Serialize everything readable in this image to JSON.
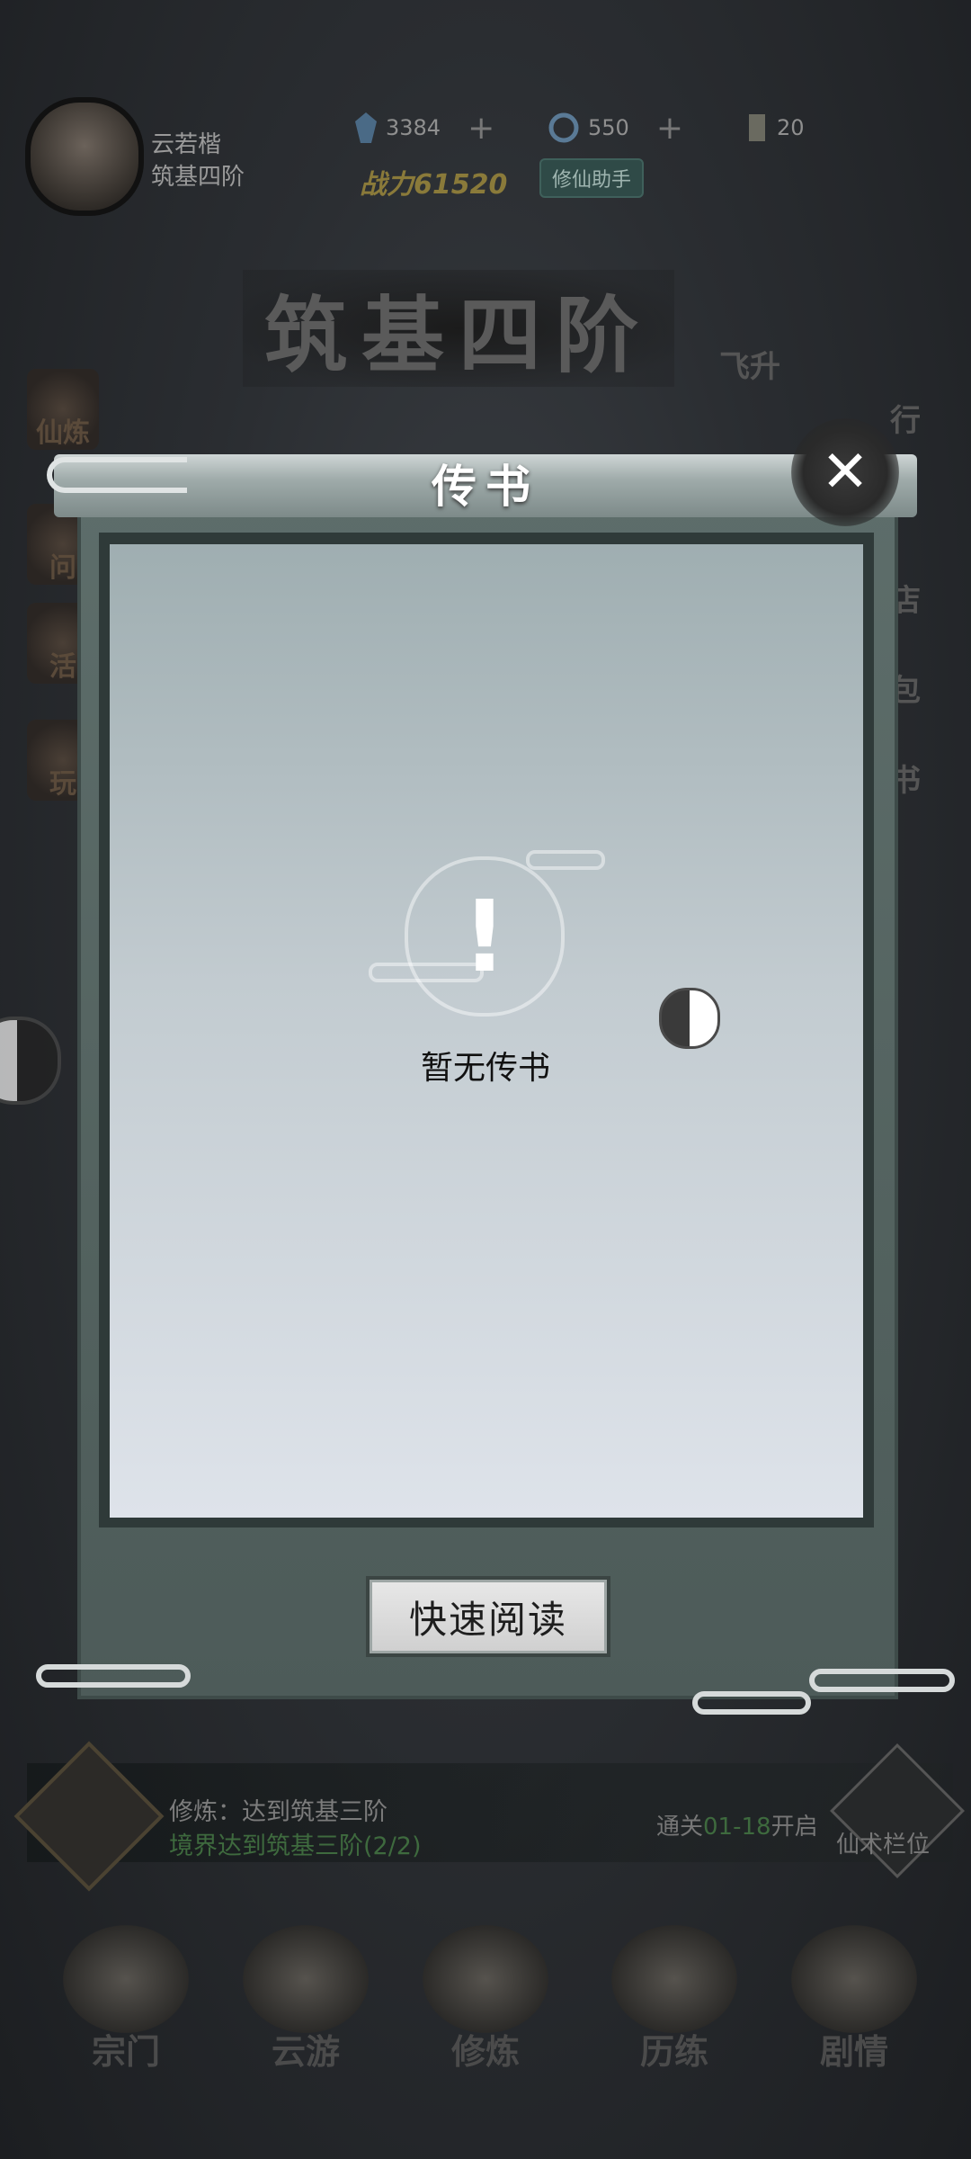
{
  "player": {
    "name": "云若楷",
    "rank": "筑基四阶"
  },
  "resources": [
    {
      "icon": "spirit-stone-icon",
      "value": "3384"
    },
    {
      "icon": "spirit-orb-icon",
      "value": "550"
    },
    {
      "icon": "scroll-icon",
      "value": "20"
    }
  ],
  "power": {
    "label": "战力",
    "value": "61520"
  },
  "helper_button": "修仙助手",
  "realm_title": "筑基四阶",
  "side_labels": {
    "left": [
      "仙炼",
      "问",
      "活",
      "玩"
    ],
    "right": [
      "飞升",
      "行",
      "店",
      "包",
      "书"
    ]
  },
  "modal": {
    "title": "传书",
    "empty_text": "暂无传书",
    "read_button": "快速阅读"
  },
  "quest": {
    "line1": "修炼：达到筑基三阶",
    "line2": "境界达到筑基三阶(2/2)",
    "unlock_prefix": "通关",
    "unlock_stage": "01-18",
    "unlock_suffix": "开启",
    "slot_label": "仙术栏位"
  },
  "nav": [
    "宗门",
    "云游",
    "修炼",
    "历练",
    "剧情"
  ]
}
